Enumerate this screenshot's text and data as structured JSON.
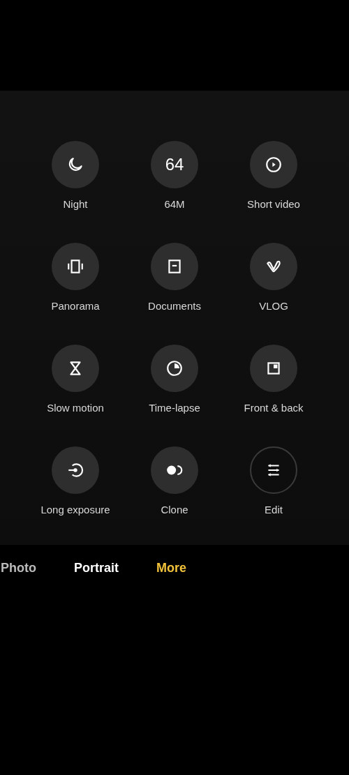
{
  "mode_rows": [
    {
      "items": [
        {
          "label": "Night",
          "kind": "filled"
        },
        {
          "label": "64M",
          "kind": "filled",
          "badge": "64"
        },
        {
          "label": "Short video",
          "kind": "filled"
        }
      ]
    },
    {
      "items": [
        {
          "label": "Panorama",
          "kind": "filled"
        },
        {
          "label": "Documents",
          "kind": "filled"
        },
        {
          "label": "VLOG",
          "kind": "filled"
        }
      ]
    },
    {
      "items": [
        {
          "label": "Slow motion",
          "kind": "filled"
        },
        {
          "label": "Time-lapse",
          "kind": "filled"
        },
        {
          "label": "Front & back",
          "kind": "filled"
        }
      ]
    },
    {
      "items": [
        {
          "label": "Long exposure",
          "kind": "filled"
        },
        {
          "label": "Clone",
          "kind": "filled"
        },
        {
          "label": "Edit",
          "kind": "outline"
        }
      ]
    }
  ],
  "mode_bar": [
    {
      "label": "Photo",
      "selected": false
    },
    {
      "label": "Portrait",
      "selected": false
    },
    {
      "label": "More",
      "selected": true
    }
  ]
}
